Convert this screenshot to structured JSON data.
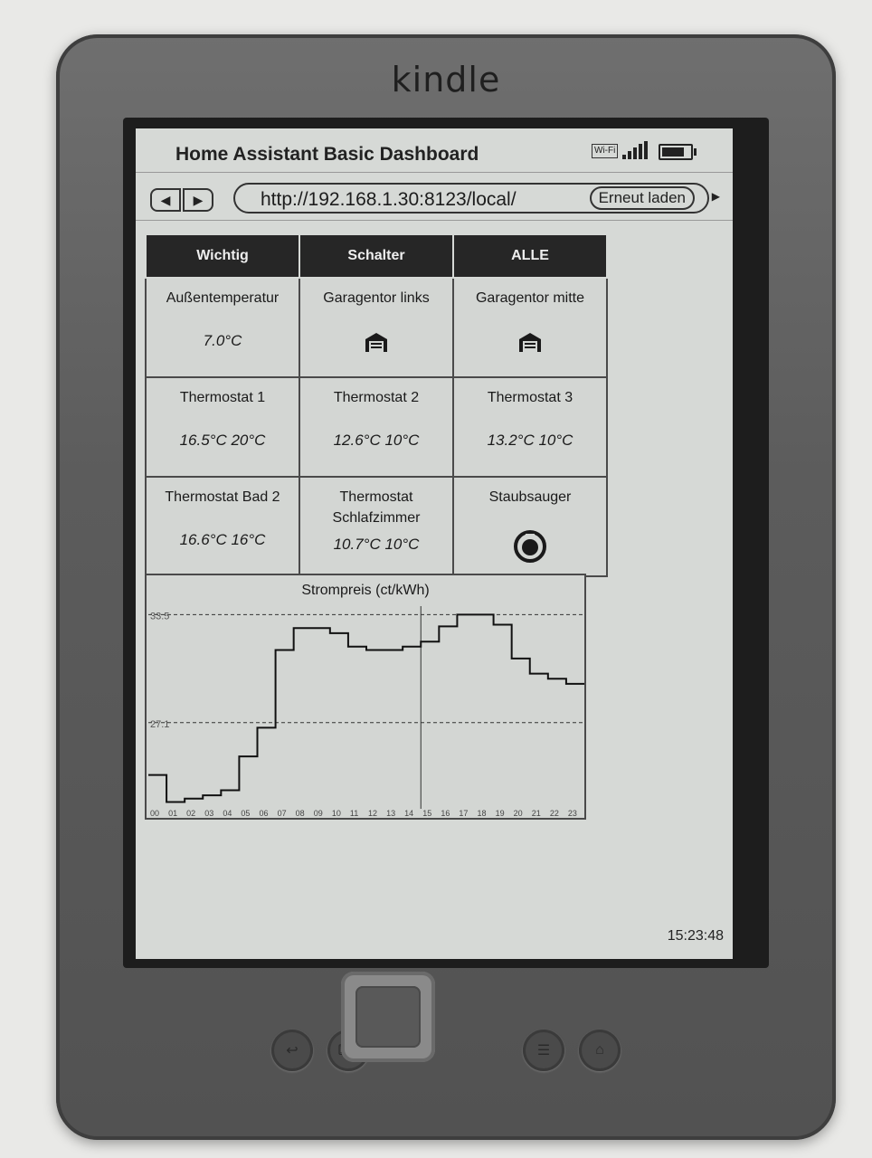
{
  "device": {
    "brand": "kindle"
  },
  "statusbar": {
    "title": "Home Assistant Basic Dashboard",
    "wifi_label": "Wi-Fi"
  },
  "navbar": {
    "back": "◀",
    "forward": "▶",
    "url": "http://192.168.1.30:8123/local/",
    "reload": "Erneut laden"
  },
  "tabs": [
    "Wichtig",
    "Schalter",
    "ALLE"
  ],
  "cells": [
    {
      "name": "Außentemperatur",
      "value": "7.0°C",
      "icon": null
    },
    {
      "name": "Garagentor links",
      "value": null,
      "icon": "garage-icon"
    },
    {
      "name": "Garagentor mitte",
      "value": null,
      "icon": "garage-icon"
    },
    {
      "name": "Thermostat 1",
      "value": "16.5°C 20°C",
      "icon": null
    },
    {
      "name": "Thermostat 2",
      "value": "12.6°C 10°C",
      "icon": null
    },
    {
      "name": "Thermostat 3",
      "value": "13.2°C 10°C",
      "icon": null
    },
    {
      "name": "Thermostat Bad 2",
      "value": "16.6°C 16°C",
      "icon": null
    },
    {
      "name": "Thermostat Schlafzimmer",
      "value": "10.7°C 10°C",
      "icon": null
    },
    {
      "name": "Staubsauger",
      "value": null,
      "icon": "robot-vacuum-icon"
    }
  ],
  "chart_data": {
    "type": "line",
    "title": "Strompreis (ct/kWh)",
    "step": true,
    "x": [
      "00",
      "01",
      "02",
      "03",
      "04",
      "05",
      "06",
      "07",
      "08",
      "09",
      "10",
      "11",
      "12",
      "13",
      "14",
      "15",
      "16",
      "17",
      "18",
      "19",
      "20",
      "21",
      "22",
      "23"
    ],
    "values": [
      24.0,
      22.4,
      22.6,
      22.8,
      23.1,
      25.1,
      26.8,
      31.4,
      32.7,
      32.7,
      32.4,
      31.6,
      31.4,
      31.4,
      31.6,
      31.9,
      32.8,
      33.5,
      33.5,
      32.9,
      30.9,
      30.0,
      29.7,
      29.4
    ],
    "reference_lines": [
      {
        "label": "33.5",
        "value": 33.5
      },
      {
        "label": "27.1",
        "value": 27.1
      }
    ],
    "current_marker_x": "15",
    "ylim": [
      22.0,
      34.0
    ]
  },
  "clock": "15:23:48"
}
